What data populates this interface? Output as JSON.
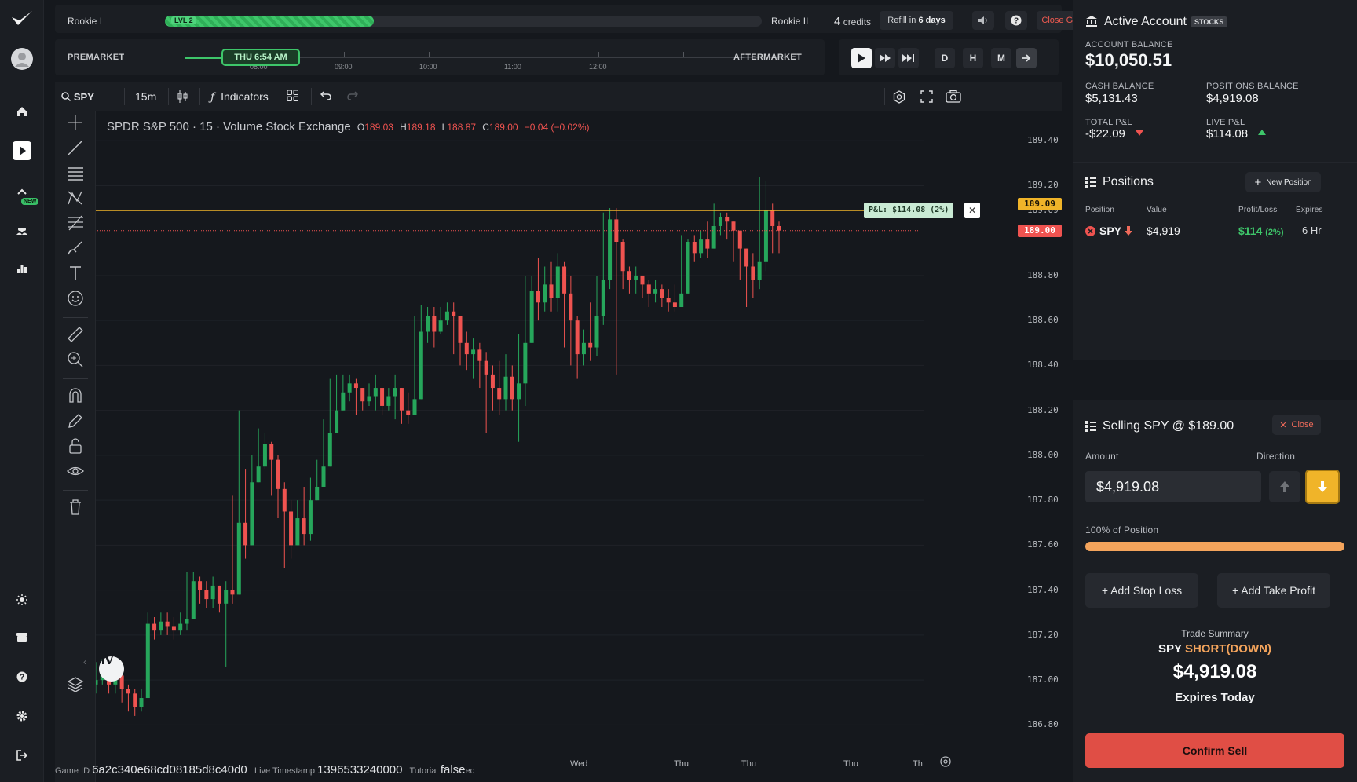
{
  "topbar": {
    "level_from": "Rookie I",
    "level_badge": "LVL 2",
    "level_progress": 0.35,
    "level_to": "Rookie II",
    "credits_count": "4",
    "credits_label": "credits",
    "refill_prefix": "Refill in",
    "refill_value": "6 days",
    "close_game": "Close Game",
    "sound_icon": "speaker-icon",
    "help_icon": "help-icon"
  },
  "timeline": {
    "premarket": "PREMARKET",
    "aftermarket": "AFTERMARKET",
    "current": "THU 6:54 AM",
    "ticks": [
      "08:00",
      "09:00",
      "10:00",
      "11:00",
      "12:00"
    ]
  },
  "playback": {
    "buttons": [
      "play-icon",
      "fast-forward-icon",
      "skip-end-icon"
    ],
    "intervals": [
      "D",
      "H",
      "M"
    ],
    "go_icon": "arrow-right-icon"
  },
  "toolbar": {
    "symbol": "SPY",
    "interval": "15m",
    "indicators": "Indicators"
  },
  "chart_legend": {
    "title": "SPDR S&P 500 · 15 · Volume Stock Exchange",
    "o_label": "O",
    "o": "189.03",
    "h_label": "H",
    "h": "189.18",
    "l_label": "L",
    "l": "188.87",
    "c_label": "C",
    "c": "189.00",
    "change": "−0.04 (−0.02%)"
  },
  "price_tags": {
    "position_line": "189.09",
    "current_price": "189.00"
  },
  "pnl_tag": "P&L: $114.08 (2%)",
  "chart_data": {
    "type": "candlestick",
    "ylim": [
      186.7,
      189.53
    ],
    "y_ticks": [
      "189.40",
      "189.20",
      "189.09",
      "189.00",
      "188.80",
      "188.60",
      "188.40",
      "188.20",
      "188.00",
      "187.80",
      "187.60",
      "187.40",
      "187.20",
      "187.00",
      "186.80"
    ],
    "x_labels": [
      "Wed",
      "Thu",
      "Thu",
      "Thu",
      "Th"
    ],
    "position_price": 189.09,
    "current_price": 189.0,
    "colors": {
      "up": "#26a65b",
      "down": "#ef5350",
      "position_line": "#f0b429",
      "current_line": "#ef5350"
    },
    "close": [
      187.0,
      187.04,
      186.98,
      187.02,
      186.96,
      186.94,
      186.88,
      186.92,
      187.25,
      187.22,
      187.26,
      187.24,
      187.22,
      187.25,
      187.27,
      187.44,
      187.4,
      187.36,
      187.42,
      187.34,
      187.4,
      187.38,
      187.7,
      187.6,
      187.88,
      187.95,
      188.05,
      187.98,
      187.85,
      187.75,
      187.6,
      187.72,
      187.65,
      187.8,
      187.86,
      187.95,
      188.1,
      188.2,
      188.28,
      188.32,
      188.3,
      188.24,
      188.26,
      188.3,
      188.22,
      188.26,
      188.3,
      188.2,
      188.18,
      188.25,
      188.55,
      188.62,
      188.55,
      188.6,
      188.64,
      188.62,
      188.5,
      188.45,
      188.47,
      188.42,
      188.36,
      188.3,
      188.25,
      188.35,
      188.25,
      188.32,
      188.5,
      188.73,
      188.68,
      188.76,
      188.7,
      188.84,
      188.72,
      188.6,
      188.45,
      188.5,
      188.48,
      188.62,
      188.78,
      189.05,
      188.95,
      188.82,
      188.78,
      188.8,
      188.76,
      188.72,
      188.74,
      188.7,
      188.68,
      188.66,
      188.72,
      188.95,
      188.9,
      188.96,
      188.92,
      189.02,
      189.06,
      189.04,
      189.0,
      188.92,
      188.84,
      188.78,
      188.86,
      189.09,
      189.02,
      189.0
    ],
    "high": [
      187.08,
      187.1,
      187.06,
      187.06,
      187.0,
      186.98,
      186.96,
      186.96,
      187.3,
      187.28,
      187.3,
      187.3,
      187.28,
      187.3,
      187.48,
      187.48,
      187.46,
      187.44,
      187.46,
      187.42,
      187.44,
      187.82,
      188.2,
      187.94,
      188.0,
      188.12,
      188.1,
      188.06,
      188.0,
      187.88,
      187.8,
      187.8,
      187.86,
      187.9,
      187.98,
      188.16,
      188.34,
      188.36,
      188.36,
      188.36,
      188.34,
      188.3,
      188.32,
      188.36,
      188.3,
      188.3,
      188.36,
      188.28,
      188.28,
      188.62,
      188.67,
      188.66,
      188.66,
      188.66,
      188.68,
      188.68,
      188.62,
      188.55,
      188.52,
      188.5,
      188.46,
      188.4,
      188.42,
      188.45,
      188.4,
      188.54,
      188.8,
      188.8,
      188.88,
      188.84,
      188.86,
      188.9,
      188.86,
      188.8,
      188.62,
      188.56,
      188.68,
      188.8,
      189.08,
      189.1,
      189.1,
      188.96,
      188.84,
      188.84,
      188.8,
      188.78,
      188.78,
      188.76,
      188.74,
      188.76,
      188.98,
      188.96,
      188.98,
      189.0,
      189.04,
      189.12,
      189.08,
      189.08,
      189.04,
      189.0,
      188.9,
      188.9,
      189.24,
      189.22,
      189.12,
      189.04
    ],
    "low": [
      186.94,
      186.98,
      186.94,
      186.94,
      186.9,
      186.86,
      186.84,
      186.86,
      187.18,
      187.18,
      187.2,
      187.2,
      187.18,
      187.2,
      187.22,
      187.36,
      187.34,
      187.32,
      187.32,
      187.3,
      187.06,
      187.34,
      187.56,
      187.54,
      187.84,
      187.9,
      187.94,
      187.82,
      187.72,
      187.5,
      187.54,
      187.6,
      187.6,
      187.62,
      187.8,
      187.9,
      188.04,
      188.14,
      188.2,
      188.24,
      188.18,
      188.2,
      188.22,
      188.2,
      188.18,
      188.2,
      188.16,
      188.14,
      188.14,
      188.2,
      188.5,
      188.5,
      188.48,
      188.54,
      188.58,
      188.45,
      188.4,
      188.38,
      188.34,
      188.3,
      188.1,
      188.2,
      188.18,
      188.2,
      188.2,
      188.06,
      188.22,
      188.62,
      188.6,
      188.64,
      188.64,
      188.64,
      188.48,
      188.4,
      188.34,
      188.4,
      188.42,
      188.44,
      188.58,
      188.74,
      188.36,
      188.74,
      188.72,
      188.72,
      188.7,
      188.66,
      188.68,
      188.66,
      188.64,
      188.64,
      188.7,
      188.86,
      188.86,
      188.88,
      188.88,
      188.94,
      188.98,
      188.96,
      188.86,
      188.78,
      188.66,
      188.7,
      188.74,
      188.82,
      188.9,
      188.9
    ]
  },
  "footer": {
    "game_id_label": "Game ID",
    "game_id": "6a2c340e68cd08185d8c40d0",
    "timestamp_label": "Live Timestamp",
    "timestamp": "1396533240000",
    "tutorial_label": "Tutorial",
    "tutorial": "false",
    "trailing": "ed"
  },
  "account": {
    "title": "Active Account",
    "badge": "STOCKS",
    "balance_label": "ACCOUNT BALANCE",
    "balance": "$10,050.51",
    "cash_label": "CASH BALANCE",
    "cash": "$5,131.43",
    "positions_label": "POSITIONS BALANCE",
    "positions": "$4,919.08",
    "total_pnl_label": "TOTAL P&L",
    "total_pnl": "-$22.09",
    "live_pnl_label": "LIVE P&L",
    "live_pnl": "$114.08"
  },
  "positions": {
    "title": "Positions",
    "new_button": "New Position",
    "headers": [
      "Position",
      "Value",
      "Profit/Loss",
      "Expires"
    ],
    "rows": [
      {
        "symbol": "SPY",
        "value": "$4,919",
        "pnl": "$114",
        "pnl_pct": "(2%)",
        "expires": "6 Hr"
      }
    ]
  },
  "order": {
    "title_prefix": "Selling SPY @",
    "price": "$189.00",
    "close_label": "Close",
    "amount_label": "Amount",
    "direction_label": "Direction",
    "amount_value": "$4,919.08",
    "position_pct_label": "100% of Position",
    "position_pct": 1.0,
    "stop_loss": "+ Add Stop Loss",
    "take_profit": "+ Add Take Profit",
    "summary_label": "Trade Summary",
    "summary_symbol": "SPY",
    "summary_direction": "SHORT(DOWN)",
    "summary_amount": "$4,919.08",
    "summary_expiry": "Expires Today",
    "confirm": "Confirm Sell"
  },
  "colors": {
    "accent_green": "#3ec66a",
    "accent_orange": "#f4a45c",
    "accent_yellow": "#f0b429",
    "sell_red": "#e04e45"
  }
}
